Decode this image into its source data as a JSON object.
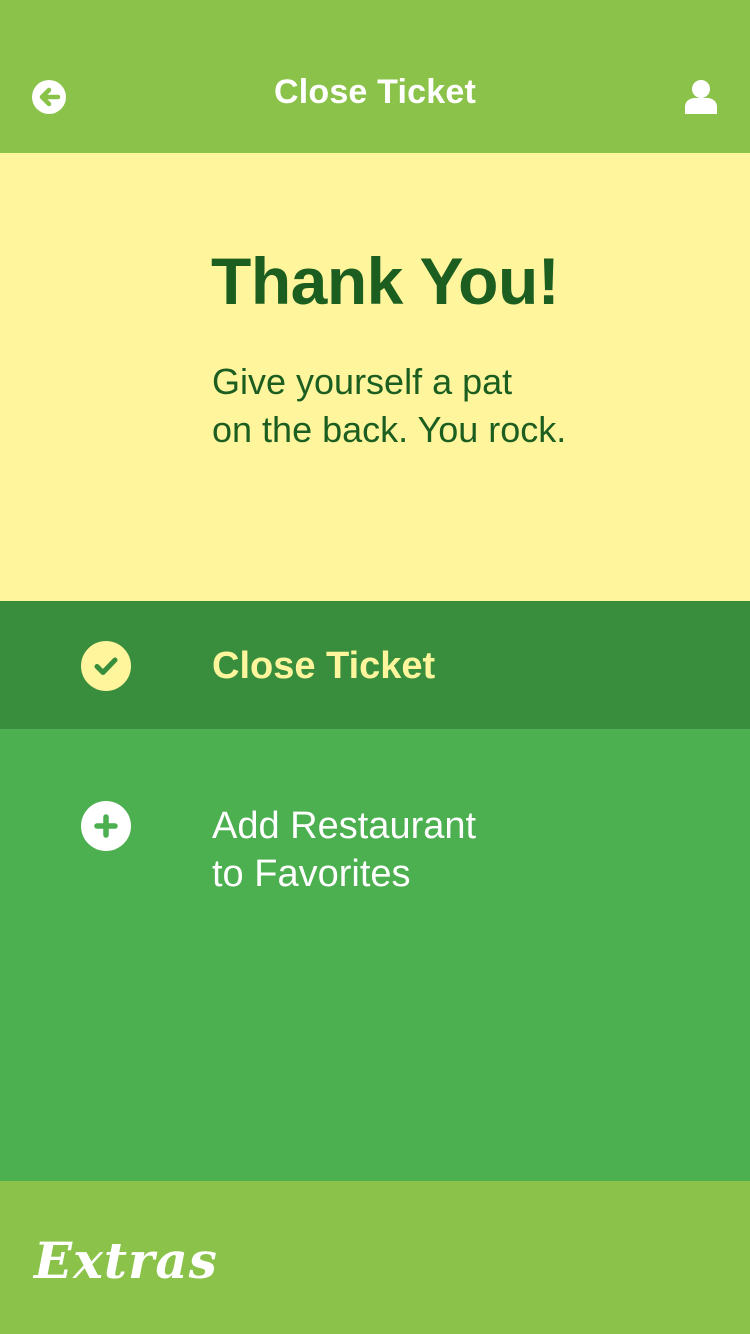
{
  "header": {
    "title": "Close Ticket",
    "back_icon": "arrow-left-circle-icon",
    "user_icon": "user-icon",
    "background": "#8bc34a"
  },
  "hero": {
    "heading": "Thank You!",
    "subtitle_lines": [
      "Give yourself a pat",
      "on the back. You rock."
    ],
    "background": "#fff59d",
    "text_color": "#1b5e20"
  },
  "actions": [
    {
      "label_lines": [
        "Close Ticket"
      ],
      "icon": "check-circle-icon",
      "background": "#388e3c",
      "text_color": "#fff59d"
    },
    {
      "label_lines": [
        "Add Restaurant",
        "to Favorites"
      ],
      "icon": "plus-circle-icon",
      "background": "#4caf50",
      "text_color": "#ffffff"
    }
  ],
  "footer": {
    "brand": "Extras",
    "background": "#8bc34a"
  }
}
